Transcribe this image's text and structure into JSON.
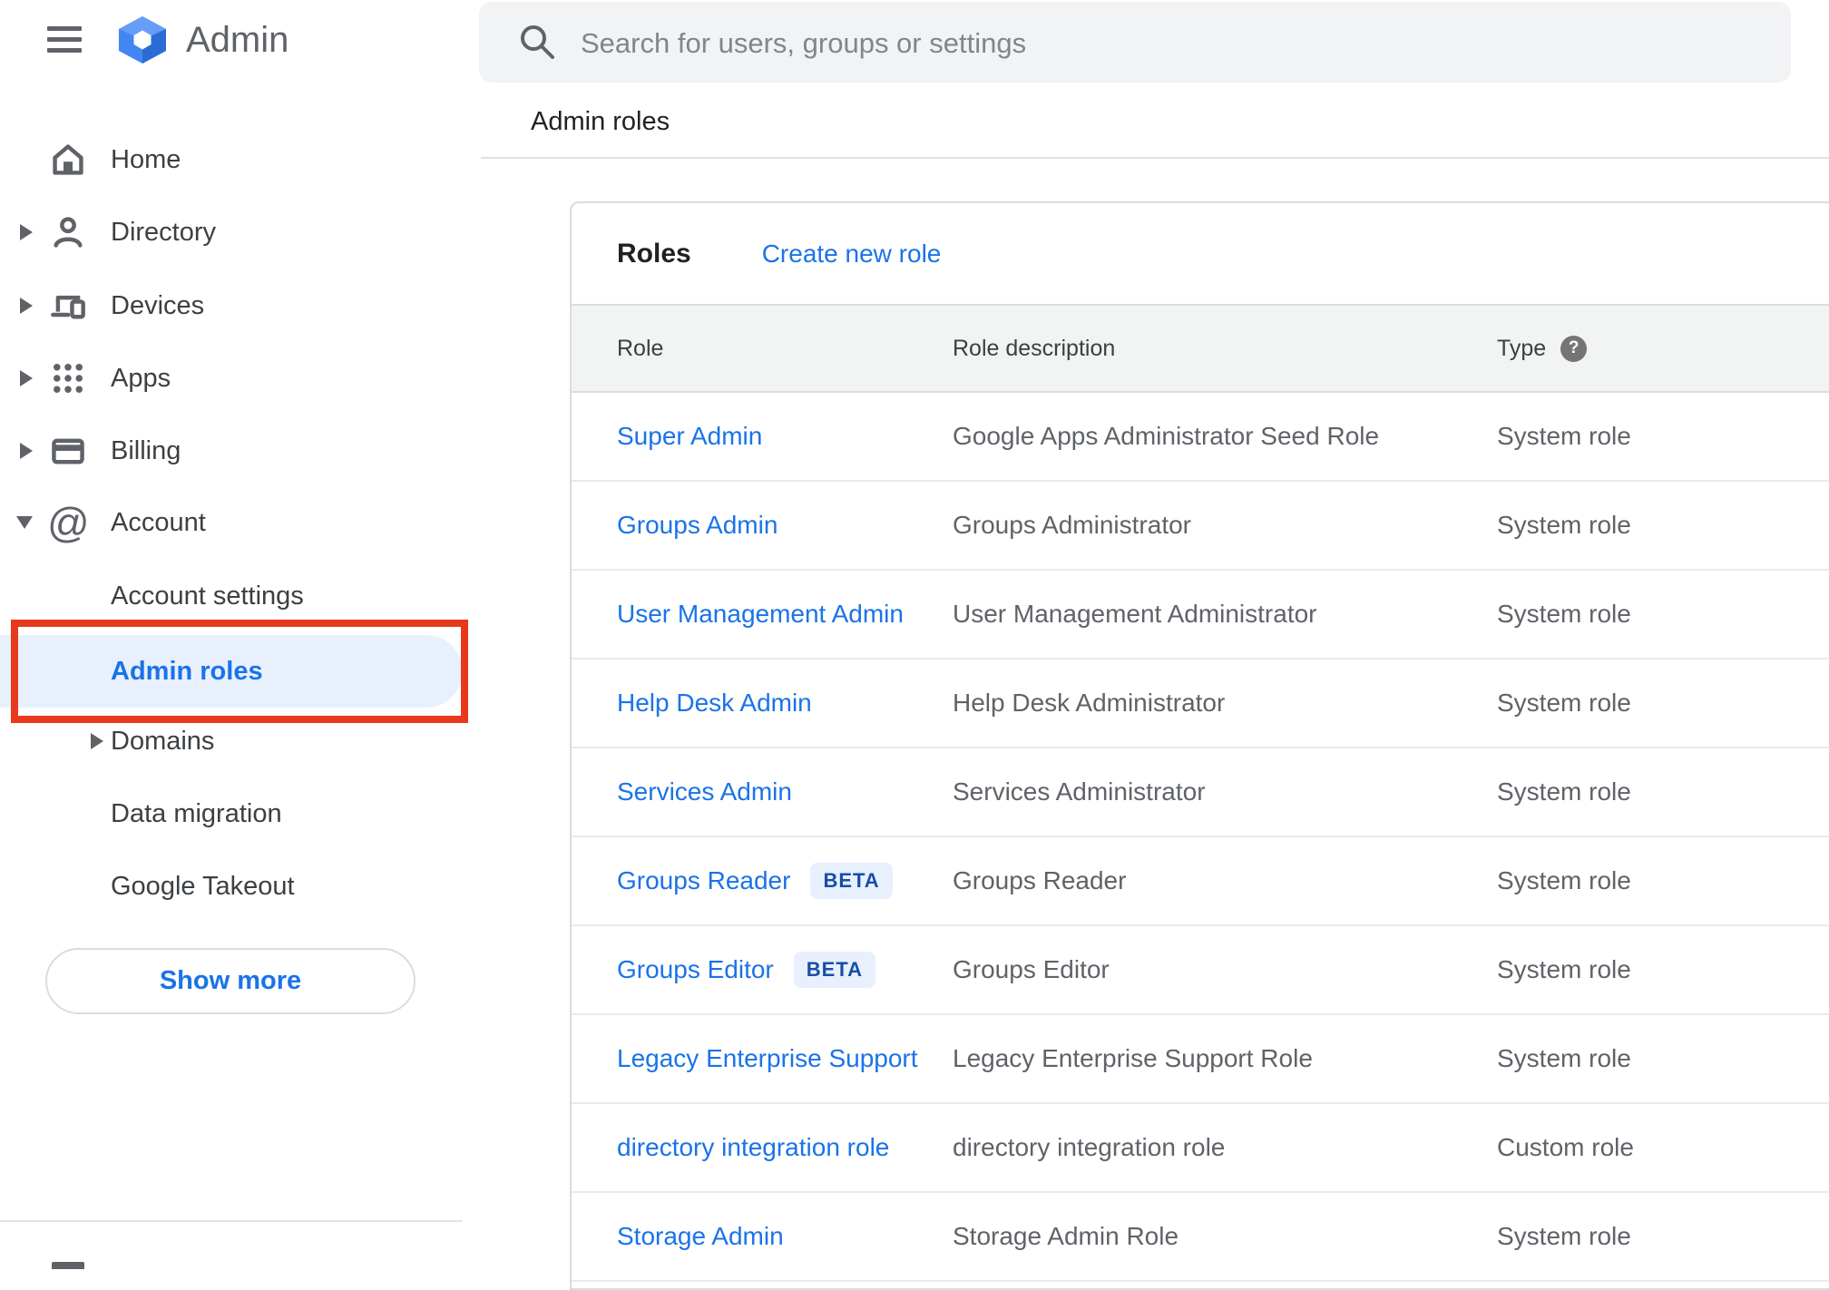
{
  "app": {
    "name": "Admin"
  },
  "search": {
    "placeholder": "Search for users, groups or settings"
  },
  "breadcrumb": "Admin roles",
  "sidebar": {
    "items": [
      {
        "label": "Home"
      },
      {
        "label": "Directory"
      },
      {
        "label": "Devices"
      },
      {
        "label": "Apps"
      },
      {
        "label": "Billing"
      },
      {
        "label": "Account"
      },
      {
        "label": "Account settings"
      },
      {
        "label": "Admin roles"
      },
      {
        "label": "Domains"
      },
      {
        "label": "Data migration"
      },
      {
        "label": "Google Takeout"
      }
    ],
    "show_more_label": "Show more"
  },
  "main": {
    "title": "Roles",
    "create_link": "Create new role",
    "table": {
      "headers": {
        "role": "Role",
        "description": "Role description",
        "type": "Type"
      },
      "help_icon": "?",
      "rows": [
        {
          "role": "Super Admin",
          "description": "Google Apps Administrator Seed Role",
          "type": "System role"
        },
        {
          "role": "Groups Admin",
          "description": "Groups Administrator",
          "type": "System role"
        },
        {
          "role": "User Management Admin",
          "description": "User Management Administrator",
          "type": "System role"
        },
        {
          "role": "Help Desk Admin",
          "description": "Help Desk Administrator",
          "type": "System role"
        },
        {
          "role": "Services Admin",
          "description": "Services Administrator",
          "type": "System role"
        },
        {
          "role": "Groups Reader",
          "badge": "BETA",
          "description": "Groups Reader",
          "type": "System role"
        },
        {
          "role": "Groups Editor",
          "badge": "BETA",
          "description": "Groups Editor",
          "type": "System role"
        },
        {
          "role": "Legacy Enterprise Support",
          "description": "Legacy Enterprise Support Role",
          "type": "System role"
        },
        {
          "role": "directory integration role",
          "description": "directory integration role",
          "type": "Custom role"
        },
        {
          "role": "Storage Admin",
          "description": "Storage Admin Role",
          "type": "System role"
        }
      ]
    }
  },
  "colors": {
    "link_blue": "#1a73e8",
    "selected_pill_bg": "#e8f0fe",
    "beta_text": "#174ea6",
    "annotation_red": "#e8391d",
    "icon_gray": "#5f6368"
  }
}
